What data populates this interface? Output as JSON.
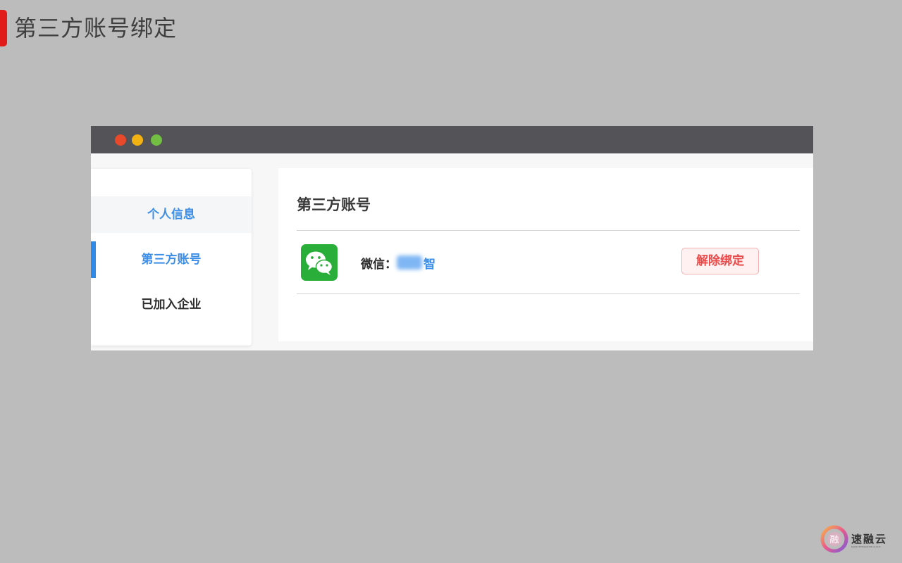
{
  "slide": {
    "title": "第三方账号绑定"
  },
  "sidebar": {
    "items": [
      {
        "label": "个人信息"
      },
      {
        "label": "第三方账号"
      },
      {
        "label": "已加入企业"
      }
    ]
  },
  "main": {
    "heading": "第三方账号",
    "wechat": {
      "label": "微信：",
      "name_visible": "智"
    },
    "unbind_label": "解除绑定"
  },
  "brand": {
    "name": "速融云",
    "tagline": "RAPID INTEGRATION CLOUD"
  },
  "colors": {
    "slide_background": "#bcbcbc",
    "accent_red": "#e11a1a",
    "window_titlebar": "#545357",
    "link_blue": "#3d8ee8",
    "wechat_green": "#2aae3a",
    "danger_red": "#ea4a4a"
  },
  "icons": {
    "window_controls": [
      "close-dot",
      "minimize-dot",
      "maximize-dot"
    ],
    "wechat": "wechat-icon",
    "brand_logo": "brand-logo"
  }
}
